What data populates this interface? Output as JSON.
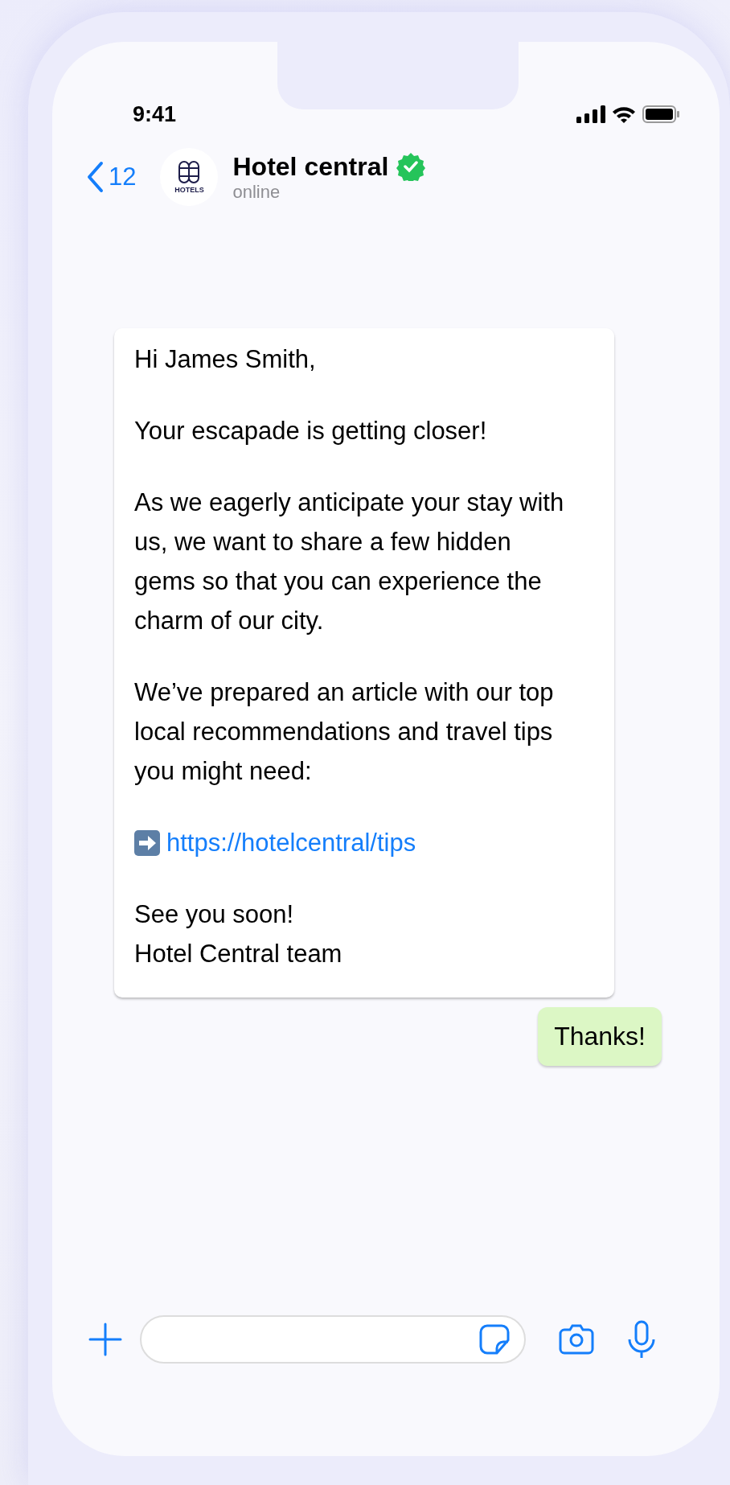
{
  "status_bar": {
    "time": "9:41"
  },
  "header": {
    "back_count": "12",
    "avatar_label": "HOTELS",
    "name": "Hotel central",
    "verified": true,
    "status": "online"
  },
  "message": {
    "blocks": [
      {
        "kind": "text",
        "lines": [
          "Hi James Smith,"
        ]
      },
      {
        "kind": "text",
        "lines": [
          "Your escapade is getting closer!"
        ]
      },
      {
        "kind": "text",
        "lines": [
          "As we eagerly anticipate your stay with us, we want to share a few hidden gems so that you can experience the charm of our city."
        ]
      },
      {
        "kind": "text",
        "lines": [
          "We’ve prepared an article with our top local recommendations and travel tips you might need:"
        ]
      },
      {
        "kind": "link",
        "lines": [
          "https://hotelcentral/tips"
        ]
      },
      {
        "kind": "text",
        "lines": [
          "See you soon!",
          "Hotel Central team"
        ]
      }
    ]
  },
  "reply": {
    "text": "Thanks!"
  }
}
